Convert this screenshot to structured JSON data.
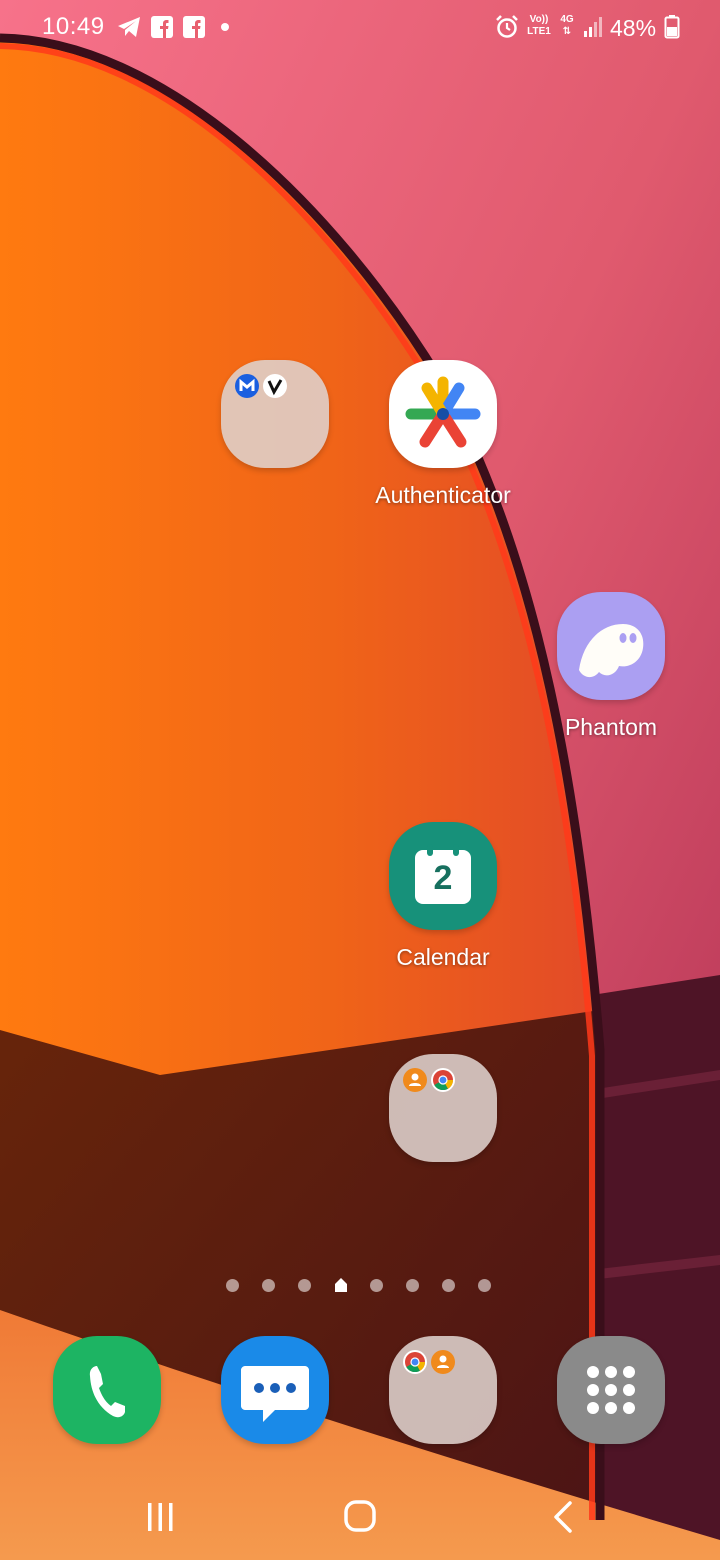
{
  "status_bar": {
    "time": "10:49",
    "battery_percent": "48%",
    "network_volte": "Vo))",
    "network_lte": "LTE1",
    "network_type": "4G",
    "icons": [
      "telegram-icon",
      "facebook-icon",
      "facebook-icon",
      "notification-dot-icon",
      "alarm-icon",
      "volte-icon",
      "4g-icon",
      "signal-icon",
      "battery-icon"
    ]
  },
  "home": {
    "apps": {
      "folder_1": {
        "label": "",
        "mini_icons": [
          "malwarebytes-icon",
          "v-app-icon"
        ]
      },
      "authenticator": {
        "label": "Authenticator"
      },
      "phantom": {
        "label": "Phantom"
      },
      "calendar": {
        "label": "Calendar",
        "day": "2"
      },
      "folder_2": {
        "label": "",
        "mini_icons": [
          "contacts-icon",
          "chrome-icon"
        ]
      }
    },
    "page_indicator": {
      "count": 8,
      "current_index": 3,
      "current_is_home": true
    }
  },
  "dock": {
    "phone": {
      "label": ""
    },
    "messages": {
      "label": ""
    },
    "folder": {
      "label": "",
      "mini_icons": [
        "chrome-icon",
        "contacts-icon"
      ]
    },
    "apps_drawer": {
      "label": ""
    }
  },
  "nav_bar": {
    "buttons": [
      "recent-apps",
      "home",
      "back"
    ]
  },
  "colors": {
    "phone": "#1db463",
    "messages": "#1a8ae8",
    "calendar": "#17917a",
    "phantom": "#ab9ff2",
    "apps_drawer": "#8a8a8a"
  }
}
